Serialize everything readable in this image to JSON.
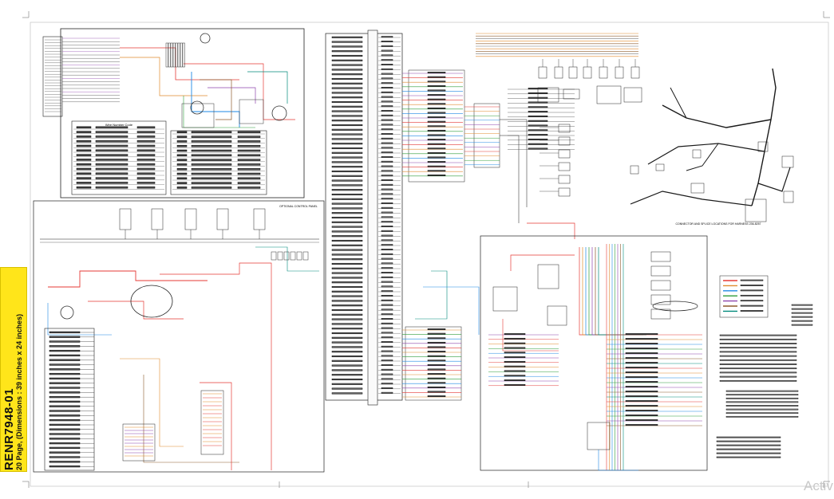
{
  "document": {
    "title_line1": "RENR7948-01",
    "title_line2": "20 Page, (Dimensions : 39 inches x 24 inches)"
  },
  "sections": {
    "wire_number_table_heading": "Wire Number Code",
    "optional_block_heading": "OPTIONAL CONTROL PANEL",
    "connector_locations_caption": "CONNECTOR AND SPLICE LOCATIONS FOR HARNESS 236-8257"
  },
  "overlay": {
    "watermark": "Activ"
  },
  "colors": {
    "sidebar_fill": "#ffe51a",
    "wire_red": "#e53935",
    "wire_orange": "#e08a2c",
    "wire_blue": "#1e88e5",
    "wire_green": "#2e9d3a",
    "wire_purple": "#8e44ad",
    "wire_brown": "#8d5a2b",
    "wire_teal": "#00897b",
    "ink": "#1a1a1a"
  }
}
